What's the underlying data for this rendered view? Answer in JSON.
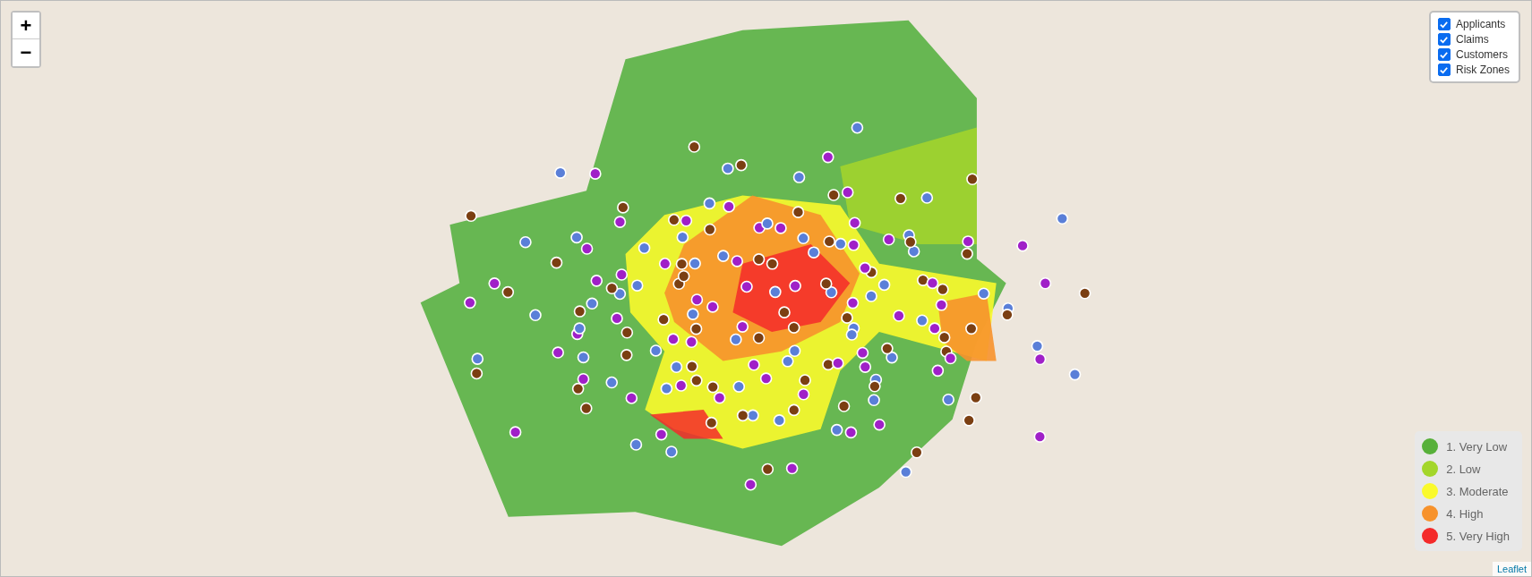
{
  "zoom_controls": [
    {
      "label": "+"
    },
    {
      "label": "−"
    }
  ],
  "layers": [
    {
      "label": "Applicants",
      "checked": true
    },
    {
      "label": "Claims",
      "checked": true
    },
    {
      "label": "Customers",
      "checked": true
    },
    {
      "label": "Risk Zones",
      "checked": true
    }
  ],
  "legend": {
    "items": [
      {
        "label": "1. Very Low",
        "color": "#57b03a"
      },
      {
        "label": "2. Low",
        "color": "#a3d62a"
      },
      {
        "label": "3. Moderate",
        "color": "#fafa2c"
      },
      {
        "label": "4. High",
        "color": "#f7922c"
      },
      {
        "label": "5. Very High",
        "color": "#f42a2a"
      }
    ]
  },
  "attribution": "Leaflet"
}
